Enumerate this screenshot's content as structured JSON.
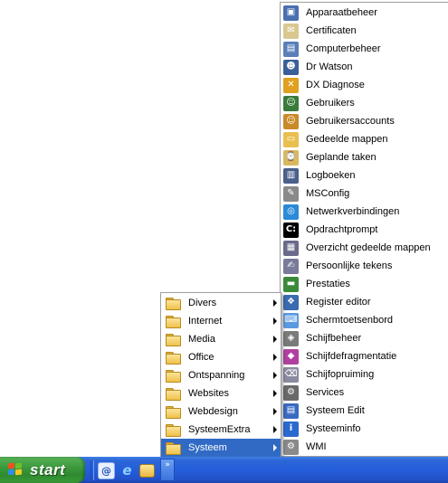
{
  "submenu": {
    "items": [
      {
        "label": "Divers",
        "has_submenu": true,
        "highlighted": false
      },
      {
        "label": "Internet",
        "has_submenu": true,
        "highlighted": false
      },
      {
        "label": "Media",
        "has_submenu": true,
        "highlighted": false
      },
      {
        "label": "Office",
        "has_submenu": true,
        "highlighted": false
      },
      {
        "label": "Ontspanning",
        "has_submenu": true,
        "highlighted": false
      },
      {
        "label": "Websites",
        "has_submenu": true,
        "highlighted": false
      },
      {
        "label": "Webdesign",
        "has_submenu": true,
        "highlighted": false
      },
      {
        "label": "SysteemExtra",
        "has_submenu": true,
        "highlighted": false
      },
      {
        "label": "Systeem",
        "has_submenu": true,
        "highlighted": true
      }
    ]
  },
  "apps_menu": {
    "items": [
      {
        "label": "Apparaatbeheer",
        "icon": "device-manager-icon"
      },
      {
        "label": "Certificaten",
        "icon": "certificates-icon"
      },
      {
        "label": "Computerbeheer",
        "icon": "computer-management-icon"
      },
      {
        "label": "Dr Watson",
        "icon": "dr-watson-icon"
      },
      {
        "label": "DX Diagnose",
        "icon": "dx-diagnose-icon"
      },
      {
        "label": "Gebruikers",
        "icon": "users-icon"
      },
      {
        "label": "Gebruikersaccounts",
        "icon": "user-accounts-icon"
      },
      {
        "label": "Gedeelde mappen",
        "icon": "shared-folders-icon"
      },
      {
        "label": "Geplande taken",
        "icon": "scheduled-tasks-icon"
      },
      {
        "label": "Logboeken",
        "icon": "event-logs-icon"
      },
      {
        "label": "MSConfig",
        "icon": "msconfig-icon"
      },
      {
        "label": "Netwerkverbindingen",
        "icon": "network-connections-icon"
      },
      {
        "label": "Opdrachtprompt",
        "icon": "command-prompt-icon"
      },
      {
        "label": "Overzicht gedeelde mappen",
        "icon": "shared-folders-overview-icon"
      },
      {
        "label": "Persoonlijke tekens",
        "icon": "private-characters-icon"
      },
      {
        "label": "Prestaties",
        "icon": "performance-icon"
      },
      {
        "label": "Register editor",
        "icon": "registry-editor-icon"
      },
      {
        "label": "Schermtoetsenbord",
        "icon": "on-screen-keyboard-icon"
      },
      {
        "label": "Schijfbeheer",
        "icon": "disk-management-icon"
      },
      {
        "label": "Schijfdefragmentatie",
        "icon": "disk-defragmenter-icon"
      },
      {
        "label": "Schijfopruiming",
        "icon": "disk-cleanup-icon"
      },
      {
        "label": "Services",
        "icon": "services-icon"
      },
      {
        "label": "Systeem Edit",
        "icon": "system-edit-icon"
      },
      {
        "label": "Systeeminfo",
        "icon": "system-info-icon"
      },
      {
        "label": "WMI",
        "icon": "wmi-icon"
      }
    ]
  },
  "taskbar": {
    "start_label": "start",
    "quicklaunch": [
      {
        "icon": "outlook-express-icon"
      },
      {
        "icon": "internet-explorer-icon"
      },
      {
        "icon": "windows-explorer-icon"
      }
    ],
    "chevron_icon": "double-chevron-icon"
  },
  "colors": {
    "highlight": "#316ac5",
    "taskbar": "#245edb",
    "start_button": "#3c9a3c"
  }
}
